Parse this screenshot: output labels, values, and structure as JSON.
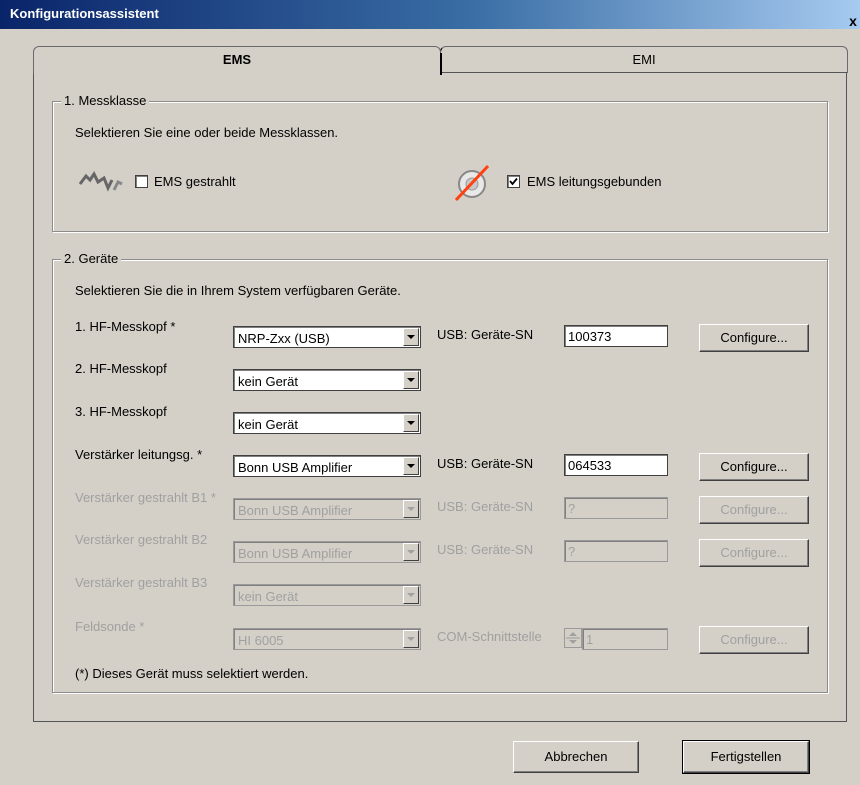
{
  "window": {
    "title": "Konfigurationsassistent",
    "close_glyph": "x"
  },
  "tabs": [
    {
      "label": "EMS"
    },
    {
      "label": "EMI"
    }
  ],
  "messklasse": {
    "group_label": "1. Messklasse",
    "instruction": "Selektieren Sie eine oder beide Messklassen.",
    "option1": {
      "label": "EMS gestrahlt",
      "checked": false,
      "icon": "radiated-wave-icon"
    },
    "option2": {
      "label": "EMS leitungsgebunden",
      "checked": true,
      "icon": "conducted-cable-icon"
    }
  },
  "geraete": {
    "group_label": "2. Geräte",
    "instruction": "Selektieren Sie die in Ihrem System verfügbaren Geräte.",
    "rows": [
      {
        "label": "1. HF-Messkopf *",
        "device": "NRP-Zxx (USB)",
        "iface": "USB: Geräte-SN",
        "value": "100373",
        "button": "Configure...",
        "enabled": true
      },
      {
        "label": "2. HF-Messkopf",
        "device": "kein Gerät",
        "enabled": true
      },
      {
        "label": "3. HF-Messkopf",
        "device": "kein Gerät",
        "enabled": true
      },
      {
        "label": "Verstärker leitungsg. *",
        "device": "Bonn USB Amplifier",
        "iface": "USB: Geräte-SN",
        "value": "064533",
        "button": "Configure...",
        "enabled": true
      },
      {
        "label": "Verstärker gestrahlt B1 *",
        "device": "Bonn USB Amplifier",
        "iface": "USB: Geräte-SN",
        "value": "?",
        "button": "Configure...",
        "enabled": false
      },
      {
        "label": "Verstärker gestrahlt B2",
        "device": "Bonn USB Amplifier",
        "iface": "USB: Geräte-SN",
        "value": "?",
        "button": "Configure...",
        "enabled": false
      },
      {
        "label": "Verstärker gestrahlt B3",
        "device": "kein Gerät",
        "enabled": false
      },
      {
        "label": "Feldsonde *",
        "device": "HI 6005",
        "iface": "COM-Schnittstelle",
        "value": "1",
        "button": "Configure...",
        "enabled": false
      }
    ],
    "footnote": "(*) Dieses Gerät muss selektiert werden."
  },
  "footer": {
    "cancel": "Abbrechen",
    "finish": "Fertigstellen"
  }
}
